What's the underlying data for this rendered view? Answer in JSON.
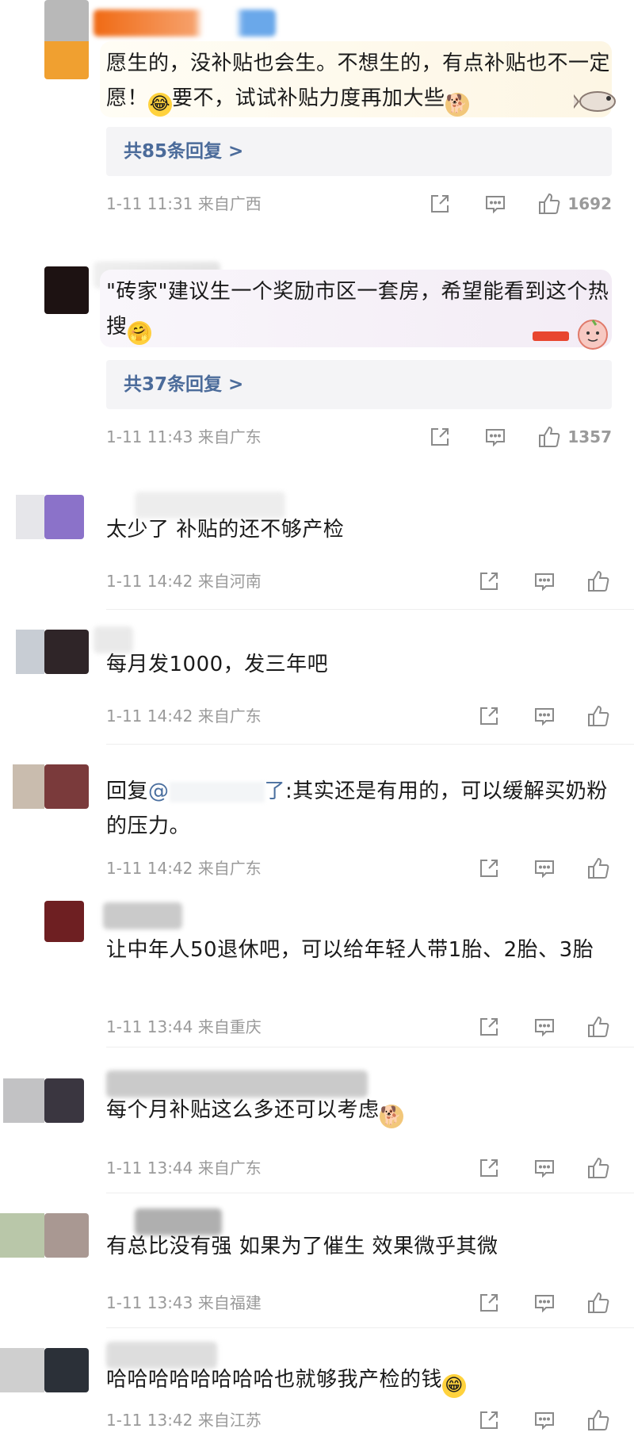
{
  "comments": [
    {
      "text": "愿生的，没补贴也会生。不想生的，有点补贴也不一定愿！",
      "text2": "要不，试试补贴力度再加大些",
      "replies": "共85条回复 >",
      "time": "1-11 11:31",
      "location": "来自广西",
      "likes": "1692",
      "avatar_colors": [
        "#b8b8b8",
        "#f0a030"
      ]
    },
    {
      "text": "\"砖家\"建议生一个奖励市区一套房，希望能看到这个热搜",
      "replies": "共37条回复 >",
      "time": "1-11 11:43",
      "location": "来自广东",
      "likes": "1357",
      "avatar_colors": [
        "#ffffff",
        "#1d1212"
      ]
    },
    {
      "text": "太少了 补贴的还不够产检",
      "time": "1-11 14:42",
      "location": "来自河南",
      "avatar_colors": [
        "#e6e6ea",
        "#8b72c9"
      ]
    },
    {
      "text": "每月发1000，发三年吧",
      "time": "1-11 14:42",
      "location": "来自广东",
      "avatar_colors": [
        "#c8cdd4",
        "#2f2528"
      ]
    },
    {
      "reply_prefix": "回复",
      "mention": "@",
      "mention_tail": "了",
      "text": ":其实还是有用的，可以缓解买奶粉的压力。",
      "time": "1-11 14:42",
      "location": "来自广东",
      "avatar_colors": [
        "#c9bcae",
        "#7a3a3b"
      ]
    },
    {
      "text": "让中年人50退休吧，可以给年轻人带1胎、2胎、3胎",
      "time": "1-11 13:44",
      "location": "来自重庆",
      "avatar_colors": [
        "#ffffff",
        "#6e1f22"
      ]
    },
    {
      "text": "每个月补贴这么多还可以考虑",
      "time": "1-11 13:44",
      "location": "来自广东",
      "avatar_colors": [
        "#c2c2c4",
        "#3a3640"
      ]
    },
    {
      "text": "有总比没有强  如果为了催生 效果微乎其微",
      "time": "1-11 13:43",
      "location": "来自福建",
      "avatar_colors": [
        "#b9c7a9",
        "#a99892"
      ]
    },
    {
      "text": "哈哈哈哈哈哈哈哈也就够我产检的钱",
      "time": "1-11 13:42",
      "location": "来自江苏",
      "avatar_colors": [
        "#cfcfcf",
        "#2b3038"
      ]
    }
  ],
  "icons": {
    "share": "share-icon",
    "comment": "comment-icon",
    "like": "thumbs-up-icon",
    "laugh": "laughing-tears-emoji",
    "doge": "doge-emoji",
    "hug": "hugging-emoji",
    "grin": "grinning-emoji"
  },
  "colors": {
    "link": "#4b6b9a",
    "meta": "#9a9a9a",
    "reply_box": "#f4f4f6"
  }
}
